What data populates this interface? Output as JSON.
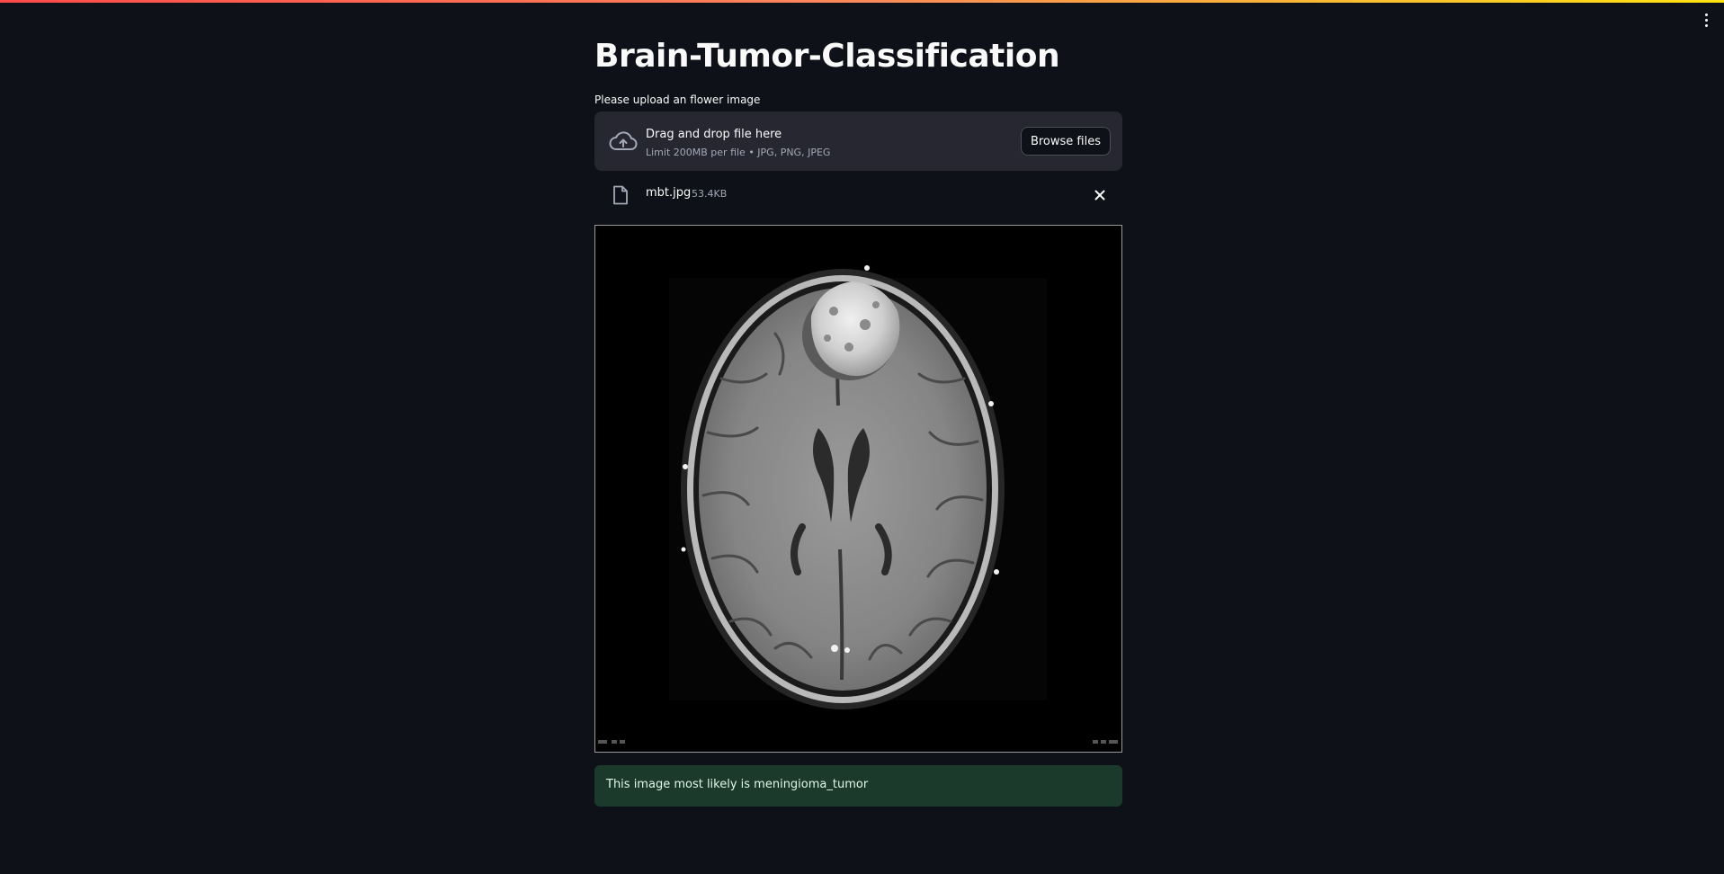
{
  "app": {
    "title": "Brain-Tumor-Classification",
    "accent_colors": [
      "#ff4b4b",
      "#ffe312"
    ]
  },
  "uploader": {
    "label": "Please upload an flower image",
    "drop_title": "Drag and drop file here",
    "limit_text": "Limit 200MB per file • JPG, PNG, JPEG",
    "browse_label": "Browse files",
    "icon": "cloud-upload-icon"
  },
  "uploaded_file": {
    "name": "mbt.jpg",
    "size": "53.4KB",
    "icon": "file-icon",
    "remove_icon": "close-icon"
  },
  "image": {
    "description_icon": "mri-scan-image"
  },
  "result": {
    "text": "This image most likely is meningioma_tumor",
    "color": "#1c3a2c"
  }
}
